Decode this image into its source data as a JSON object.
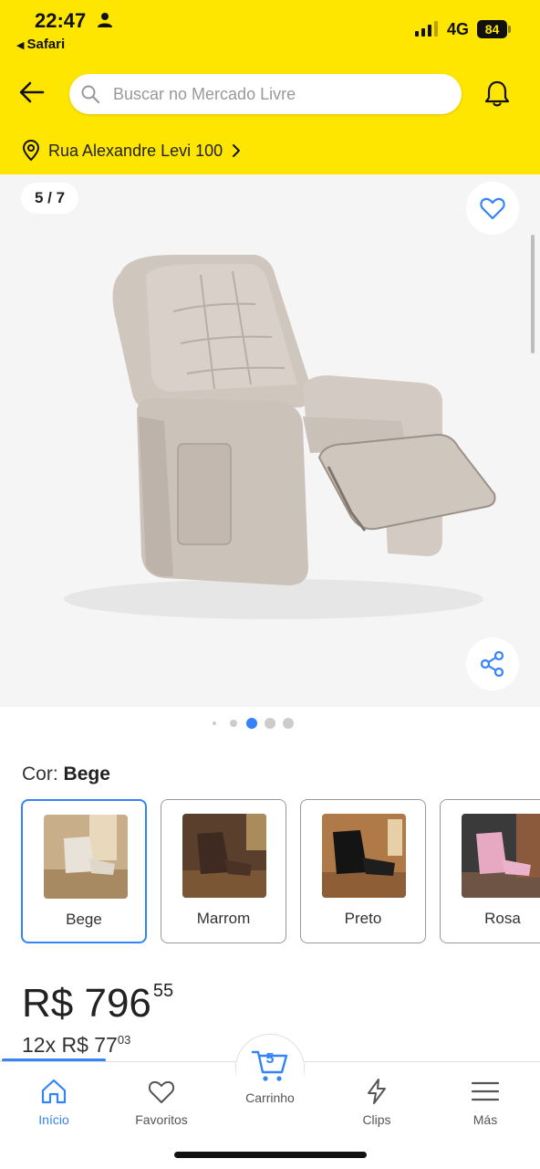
{
  "status_bar": {
    "time": "22:47",
    "back_app": "Safari",
    "network": "4G",
    "battery": "84"
  },
  "header": {
    "search_placeholder": "Buscar no Mercado Livre",
    "address": "Rua Alexandre Levi 100",
    "accent_color": "#FFE600"
  },
  "gallery": {
    "counter": "5 / 7",
    "current_image": 5,
    "total_images": 7
  },
  "color_selector": {
    "label": "Cor:",
    "selected": "Bege",
    "options": [
      {
        "label": "Bege"
      },
      {
        "label": "Marrom"
      },
      {
        "label": "Preto"
      },
      {
        "label": "Rosa"
      }
    ]
  },
  "price": {
    "currency": "R$",
    "integer": "796",
    "cents": "55",
    "installments_prefix": "12x R$",
    "installment_integer": "77",
    "installment_cents": "03"
  },
  "bottom_nav": {
    "items": [
      {
        "label": "Início",
        "icon": "home-icon",
        "active": true
      },
      {
        "label": "Favoritos",
        "icon": "heart-icon"
      },
      {
        "label": "Carrinho",
        "icon": "cart-icon",
        "badge": "5"
      },
      {
        "label": "Clips",
        "icon": "lightning-icon"
      },
      {
        "label": "Más",
        "icon": "menu-icon"
      }
    ],
    "active_color": "#3483FA"
  }
}
